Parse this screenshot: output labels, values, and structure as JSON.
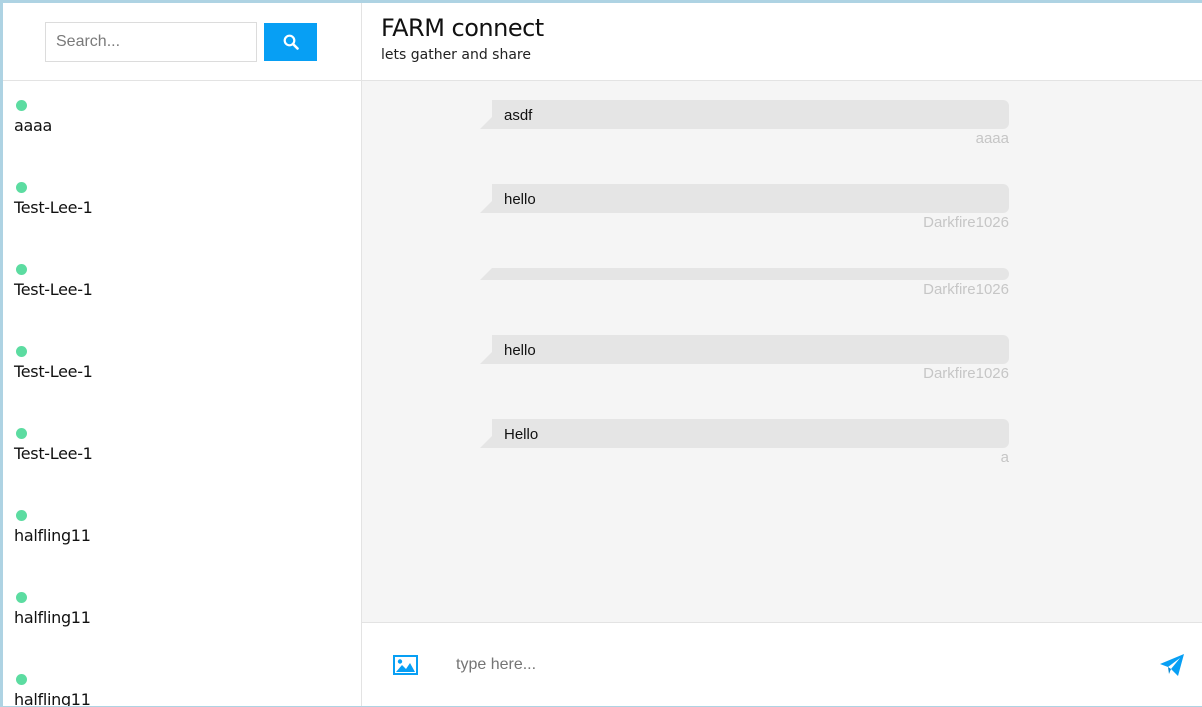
{
  "search": {
    "placeholder": "Search...",
    "button_icon": "search-icon"
  },
  "contacts": [
    {
      "name": "aaaa",
      "status": "online"
    },
    {
      "name": "Test-Lee-1",
      "status": "online"
    },
    {
      "name": "Test-Lee-1",
      "status": "online"
    },
    {
      "name": "Test-Lee-1",
      "status": "online"
    },
    {
      "name": "Test-Lee-1",
      "status": "online"
    },
    {
      "name": "halfling11",
      "status": "online"
    },
    {
      "name": "halfling11",
      "status": "online"
    },
    {
      "name": "halfling11",
      "status": "online"
    }
  ],
  "header": {
    "title": "FARM connect",
    "subtitle": "lets gather and share"
  },
  "messages": [
    {
      "text": "asdf",
      "sender": "aaaa"
    },
    {
      "text": "hello",
      "sender": "Darkfire1026"
    },
    {
      "text": "",
      "sender": "Darkfire1026"
    },
    {
      "text": "hello",
      "sender": "Darkfire1026"
    },
    {
      "text": "Hello",
      "sender": "a"
    }
  ],
  "composer": {
    "placeholder": "type here...",
    "image_icon": "image-icon",
    "send_icon": "send-icon"
  },
  "colors": {
    "accent": "#079ff4",
    "online": "#5cdca1",
    "bubble": "#e5e5e5",
    "frame": "#aed3e3"
  }
}
